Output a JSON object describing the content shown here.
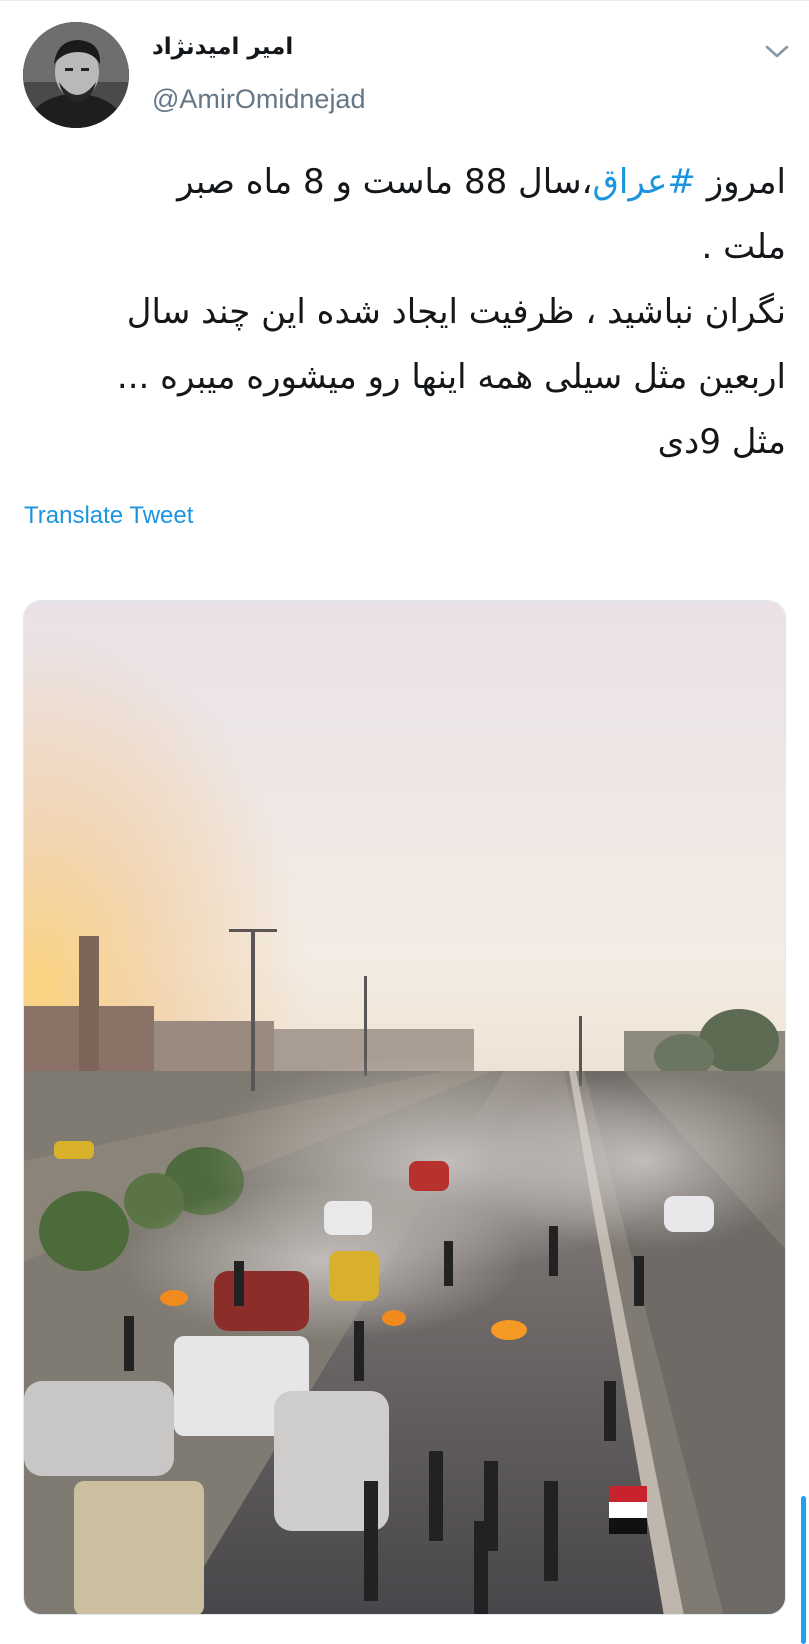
{
  "author": {
    "display_name": "امیر امیدنژاد",
    "handle": "@AmirOmidnejad"
  },
  "icons": {
    "caret": "chevron-down-icon",
    "avatar": "profile-photo"
  },
  "tweet": {
    "line1_prefix": "امروز ",
    "hashtag": "#عراق",
    "line1_suffix": "،سال 88 ماست و 8 ماه صبر",
    "line2": "ملت .",
    "line3": "نگران نباشید ، ظرفیت ایجاد شده این چند سال",
    "line4": "اربعین مثل سیلی همه اینها رو میشوره میبره ...",
    "line5": "مثل 9دی"
  },
  "translate_label": "Translate Tweet",
  "colors": {
    "link": "#1b95e0",
    "text": "#14171a",
    "secondary": "#657786",
    "accent": "#1da1f2"
  }
}
